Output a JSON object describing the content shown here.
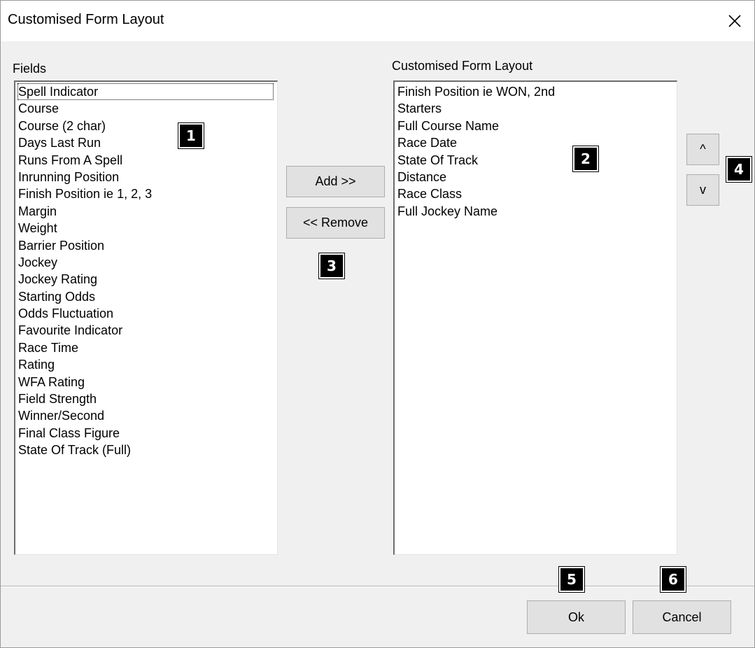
{
  "window": {
    "title": "Customised Form Layout",
    "close_glyph": "close-icon"
  },
  "fields_panel": {
    "label": "Fields",
    "items": [
      "Spell Indicator",
      "Course",
      "Course (2 char)",
      "Days Last Run",
      "Runs From A Spell",
      "Inrunning Position",
      "Finish Position ie 1, 2, 3",
      "Margin",
      "Weight",
      "Barrier Position",
      "Jockey",
      "Jockey Rating",
      "Starting Odds",
      "Odds Fluctuation",
      "Favourite Indicator",
      "Race Time",
      "Rating",
      "WFA Rating",
      "Field Strength",
      "Winner/Second",
      "Final Class Figure",
      "State Of Track (Full)"
    ]
  },
  "layout_panel": {
    "label": "Customised Form Layout",
    "items": [
      "Finish Position ie WON, 2nd",
      "Starters",
      "Full Course Name",
      "Race Date",
      "State Of Track",
      "Distance",
      "Race Class",
      "Full Jockey Name"
    ]
  },
  "buttons": {
    "add": "Add >>",
    "remove": "<< Remove",
    "up": "^",
    "down": "v",
    "ok": "Ok",
    "cancel": "Cancel"
  },
  "markers": [
    "1",
    "2",
    "3",
    "4",
    "5",
    "6"
  ]
}
